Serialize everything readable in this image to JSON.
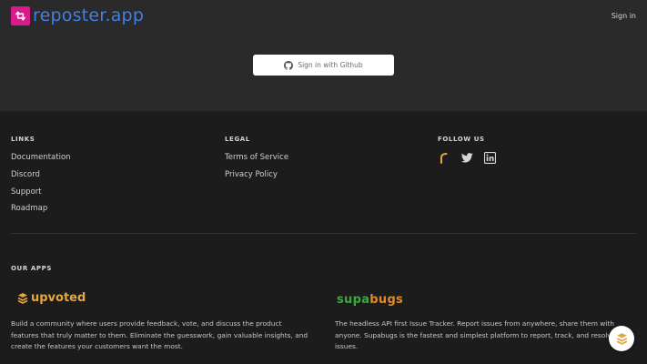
{
  "header": {
    "brand": "reposter.app",
    "sign_in": "Sign in"
  },
  "hero": {
    "github_button": "Sign in with Github"
  },
  "footer": {
    "links": {
      "heading": "LINKS",
      "items": [
        "Documentation",
        "Discord",
        "Support",
        "Roadmap"
      ]
    },
    "legal": {
      "heading": "LEGAL",
      "items": [
        "Terms of Service",
        "Privacy Policy"
      ]
    },
    "follow": {
      "heading": "FOLLOW US",
      "icons": [
        "rss-icon",
        "twitter-icon",
        "linkedin-icon"
      ]
    },
    "apps": {
      "heading": "OUR APPS",
      "upvoted": {
        "name": "upvoted",
        "description": "Build a community where users provide feedback, vote, and discuss the product features that truly matter to them. Eliminate the guesswork, gain valuable insights, and create the features your customers want the most."
      },
      "supabugs": {
        "name_a": "supa",
        "name_b": "bugs",
        "description": "The headless API first Issue Tracker. Report issues from anywhere, share them with anyone. Supabugs is the fastest and simplest platform to report, track, and resolve issues."
      }
    }
  },
  "colors": {
    "brand_pink": "#d81b8a",
    "brand_blue": "#3f7fe8",
    "upvoted_orange": "#e5a640",
    "supabugs_green": "#3aa83f",
    "supabugs_orange": "#e2892b"
  }
}
